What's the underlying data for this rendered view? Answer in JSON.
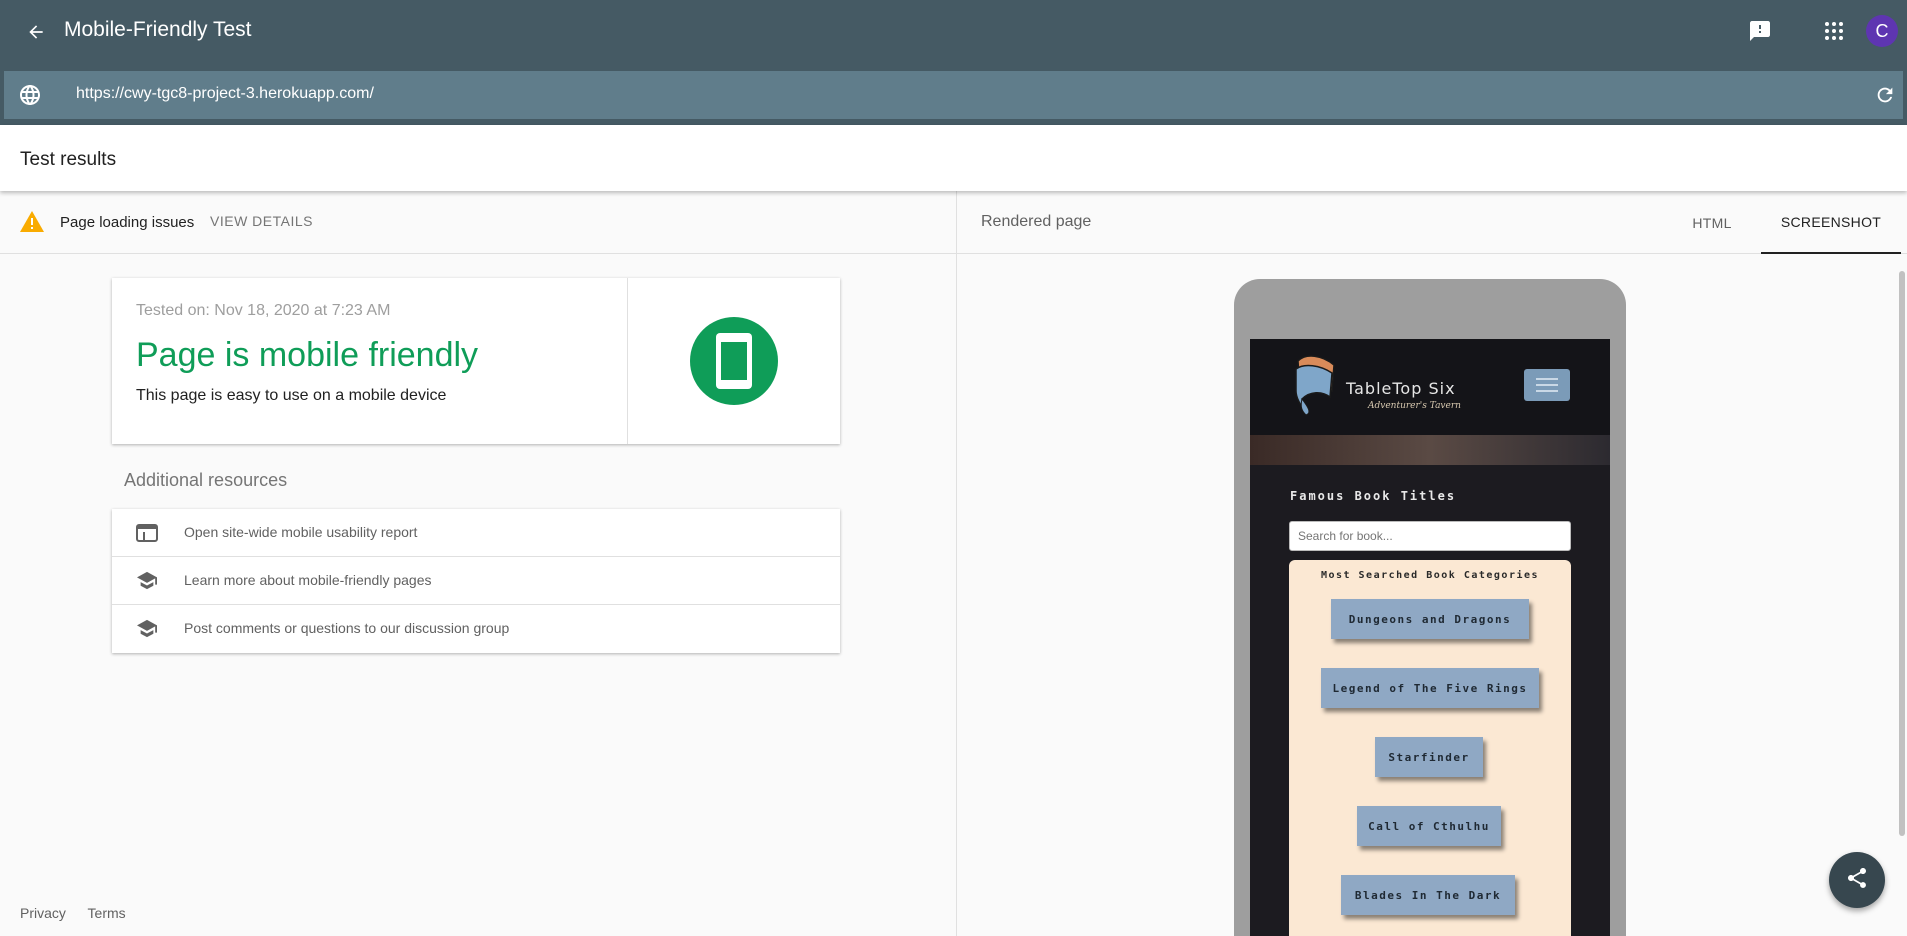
{
  "app": {
    "title": "Mobile-Friendly Test",
    "avatar_letter": "C",
    "url": "https://cwy-tgc8-project-3.herokuapp.com/"
  },
  "results": {
    "header": "Test results"
  },
  "issues": {
    "text": "Page loading issues",
    "view_details": "VIEW DETAILS",
    "icon": "warning-icon"
  },
  "result_card": {
    "tested_on": "Tested on: Nov 18, 2020 at 7:23 AM",
    "headline": "Page is mobile friendly",
    "subtext": "This page is easy to use on a mobile device",
    "status_color": "#0f9d58"
  },
  "resources": {
    "title": "Additional resources",
    "items": [
      {
        "label": "Open site-wide mobile usability report",
        "icon": "web-icon"
      },
      {
        "label": "Learn more about mobile-friendly pages",
        "icon": "school-icon"
      },
      {
        "label": "Post comments or questions to our discussion group",
        "icon": "school-icon"
      }
    ]
  },
  "footer": {
    "privacy": "Privacy",
    "terms": "Terms"
  },
  "rendered": {
    "label": "Rendered page",
    "tabs": [
      {
        "label": "HTML",
        "active": false
      },
      {
        "label": "SCREENSHOT",
        "active": true
      }
    ]
  },
  "site": {
    "brand": "TableTop Six",
    "tagline": "Adventurer's Tavern",
    "section_title": "Famous Book Titles",
    "search_placeholder": "Search for book...",
    "categories_title": "Most Searched Book Categories",
    "categories": [
      "Dungeons and Dragons",
      "Legend of The Five Rings",
      "Starfinder",
      "Call of Cthulhu",
      "Blades In The Dark"
    ]
  }
}
